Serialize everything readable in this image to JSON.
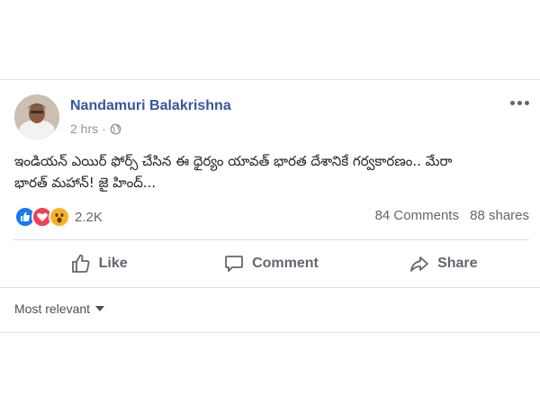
{
  "post": {
    "author": "Nandamuri Balakrishna",
    "time": "2 hrs",
    "privacy_icon": "globe-icon",
    "text_line1": "ఇండియన్ ఎయిర్ ఫోర్స్ చేసిన ఈ ధైర్యం యావత్ భారత దేశానికే గర్వకారణం.. మేరా",
    "text_line2": "భారత్ మహాన్! జై హింద్..."
  },
  "reactions": {
    "icons": [
      "like-reaction-icon",
      "love-reaction-icon",
      "wow-reaction-icon"
    ],
    "count": "2.2K",
    "comments": "84 Comments",
    "shares": "88 shares"
  },
  "actions": {
    "like": "Like",
    "comment": "Comment",
    "share": "Share"
  },
  "comments": {
    "sort_label": "Most relevant"
  },
  "colors": {
    "name_link": "#365899",
    "secondary_text": "#606770",
    "like_blue": "#1877f2",
    "love_red": "#f33e58",
    "wow_yellow": "#f7b125"
  }
}
